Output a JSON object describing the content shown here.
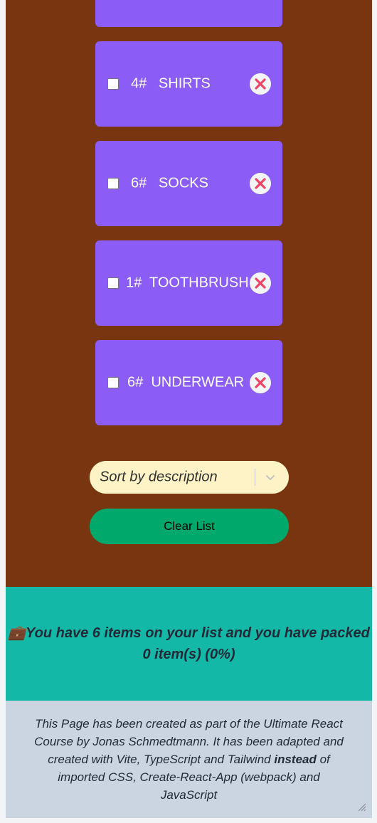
{
  "items": [
    {
      "qty": "4#",
      "description": "SHIRTS",
      "packed": false
    },
    {
      "qty": "6#",
      "description": "SOCKS",
      "packed": false
    },
    {
      "qty": "1#",
      "description": "TOOTHBRUSH",
      "packed": false
    },
    {
      "qty": "6#",
      "description": "UNDERWEAR",
      "packed": false
    }
  ],
  "item_labels": [
    "4#   SHIRTS",
    "6#   SOCKS",
    "1#  TOOTHBRUSH",
    "6#  UNDERWEAR"
  ],
  "icons": {
    "delete": "close-circle-icon",
    "sort_arrow": "chevron-down-icon",
    "stats": "briefcase-icon"
  },
  "sort": {
    "selected": "Sort by description"
  },
  "clear_button": {
    "label": "Clear List"
  },
  "stats": {
    "icon": "💼",
    "text": "You have 6 items on your list and you have packed 0 item(s) (0%)"
  },
  "footer": {
    "part1": "This Page has been created as part of the Ultimate React Course by Jonas Schmedtmann. It has been adapted and created with Vite, TypeScript and Tailwind ",
    "emphasis": "instead",
    "part2": " of imported CSS, Create-React-App (webpack) and JavaScript"
  },
  "colors": {
    "list_bg": "#78350f",
    "item_bg": "#8b5cf6",
    "sort_bg": "#fef3c7",
    "clear_bg": "#00a86b",
    "stats_bg": "#14b8a6",
    "footer_bg": "#cbd5e1",
    "delete_icon": "#ef4466"
  }
}
